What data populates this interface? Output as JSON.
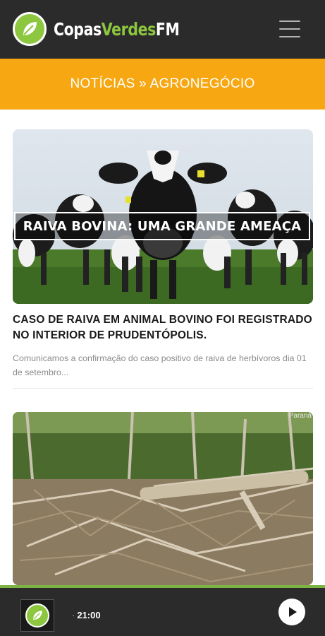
{
  "header": {
    "logo_part1": "Copas",
    "logo_part2": "Verdes",
    "logo_part3": "FM",
    "menu_icon": "hamburger-menu-icon"
  },
  "category": {
    "title": "NOTÍCIAS » AGRONEGÓCIO"
  },
  "articles": [
    {
      "image_caption": "RAIVA BOVINA: UMA GRANDE AMEAÇA",
      "title": "CASO DE RAIVA EM ANIMAL BOVINO FOI REGISTRADO NO INTERIOR DE PRUDENTÓPOLIS.",
      "excerpt": "Comunicamos a confirmação do caso positivo de raiva de herbívoros dia 01 de setembro..."
    },
    {
      "image_watermark": "Paraná"
    }
  ],
  "player": {
    "time": "21:00",
    "play_icon": "play-icon"
  },
  "colors": {
    "header_bg": "#2b2b2b",
    "category_bg": "#f6a711",
    "brand_green": "#8dc63f",
    "player_accent": "#7cb342"
  }
}
